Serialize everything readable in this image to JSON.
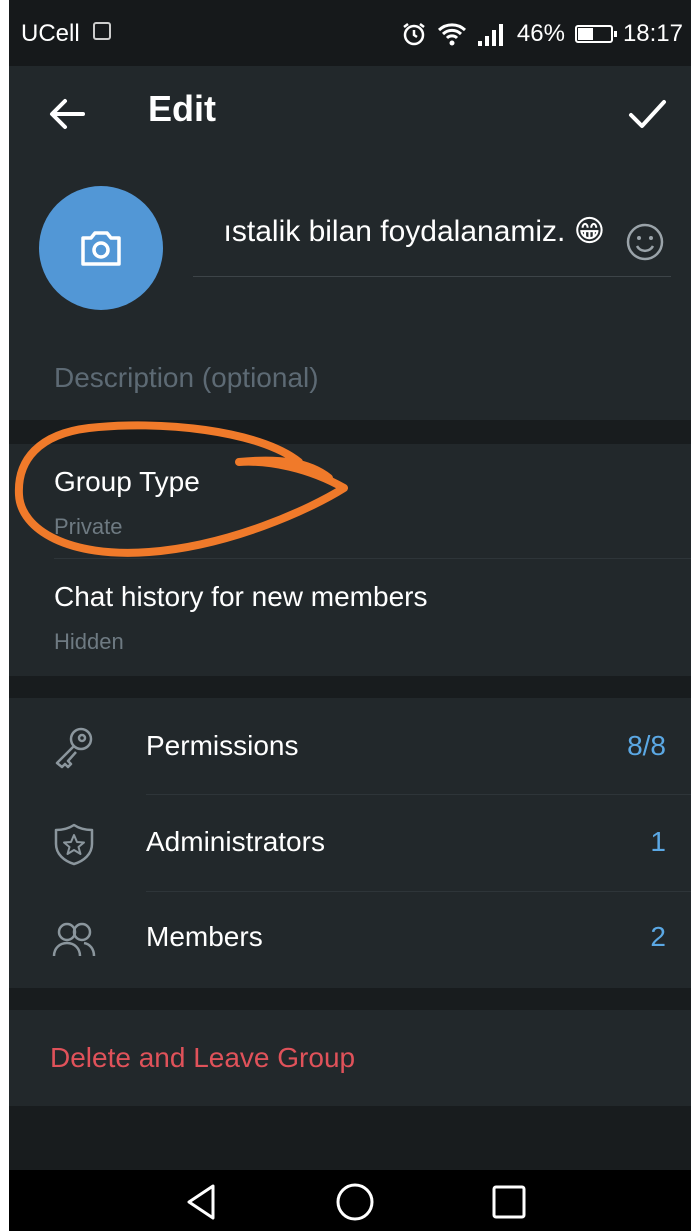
{
  "status_bar": {
    "carrier": "UCell",
    "battery": "46%",
    "battery_level": 0.46,
    "time": "18:17"
  },
  "header": {
    "title": "Edit"
  },
  "group": {
    "name": "ıstalik bilan foydalanamiz. 😁",
    "description_placeholder": "Description (optional)"
  },
  "settings": [
    {
      "title": "Group Type",
      "value": "Private"
    },
    {
      "title": "Chat history for new members",
      "value": "Hidden"
    }
  ],
  "management": [
    {
      "label": "Permissions",
      "count": "8/8",
      "icon": "key-icon"
    },
    {
      "label": "Administrators",
      "count": "1",
      "icon": "shield-star-icon"
    },
    {
      "label": "Members",
      "count": "2",
      "icon": "members-icon"
    }
  ],
  "danger_action": "Delete and Leave Group",
  "colors": {
    "accent": "#5ba8e4",
    "avatar": "#5297d6",
    "danger": "#e0525a",
    "annotation": "#f07a2a"
  }
}
